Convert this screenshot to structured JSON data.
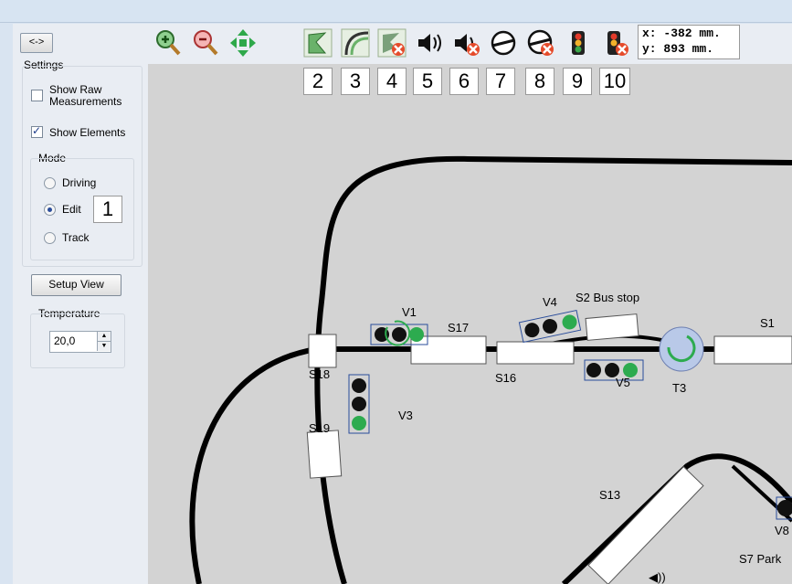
{
  "window": {
    "collapse_label": "<->"
  },
  "settings": {
    "title": "Settings",
    "show_raw_label": "Show Raw\nMeasurements",
    "show_raw_checked": false,
    "show_elements_label": "Show Elements",
    "show_elements_checked": true,
    "mode": {
      "title": "Mode",
      "options": [
        "Driving",
        "Edit",
        "Track"
      ],
      "selected": "Edit"
    },
    "setup_view_label": "Setup View",
    "temperature": {
      "title": "Temperature",
      "value": "20,0"
    }
  },
  "annotation_badges": [
    "1",
    "2",
    "3",
    "4",
    "5",
    "6",
    "7",
    "8",
    "9",
    "10"
  ],
  "toolbar": {
    "buttons": [
      {
        "icon": "zoom-in-icon"
      },
      {
        "icon": "zoom-out-icon"
      },
      {
        "icon": "fit-view-icon"
      },
      {
        "icon": "add-straight-track-icon"
      },
      {
        "icon": "add-curved-track-icon"
      },
      {
        "icon": "delete-track-icon"
      },
      {
        "icon": "add-sound-icon"
      },
      {
        "icon": "delete-sound-icon"
      },
      {
        "icon": "add-turntable-icon"
      },
      {
        "icon": "delete-turntable-icon"
      },
      {
        "icon": "add-signal-icon"
      },
      {
        "icon": "delete-signal-icon"
      }
    ],
    "coords": {
      "x": "x: -382 mm.",
      "y": "y: 893 mm."
    }
  },
  "canvas": {
    "labels": [
      "V1",
      "S17",
      "V4",
      "S2 Bus stop",
      "S1",
      "S18",
      "S16",
      "V5",
      "T3",
      "S19",
      "V3",
      "S13",
      "V8",
      "S7 Park"
    ]
  },
  "colors": {
    "track": "#000000",
    "canvas_bg": "#d3d3d3",
    "signal_green": "#2dab4f",
    "accent": "#2a4d9b"
  }
}
